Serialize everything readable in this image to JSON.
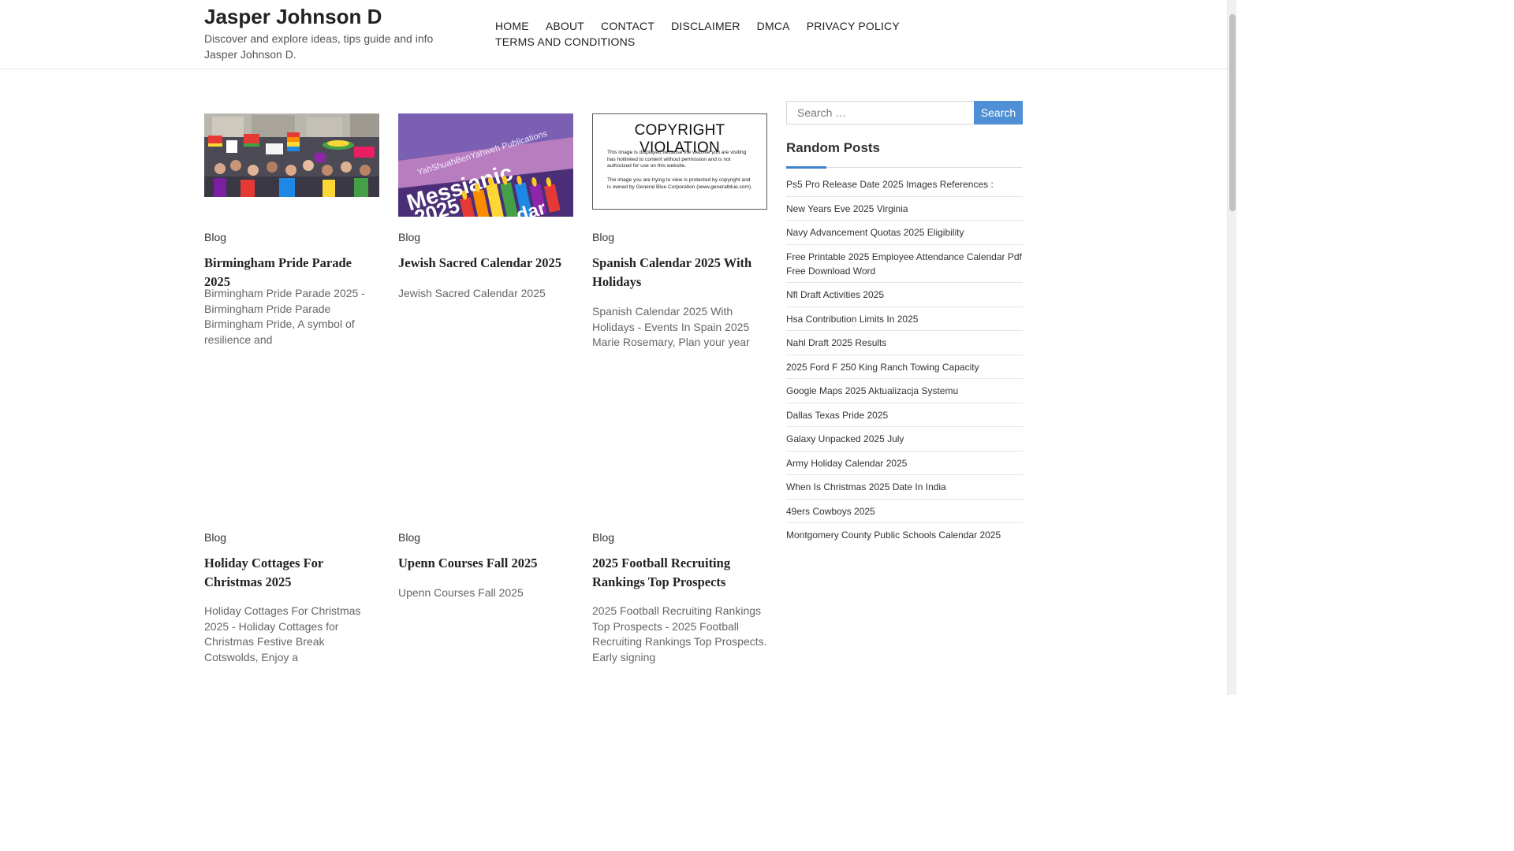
{
  "site": {
    "title": "Jasper Johnson D",
    "description": "Discover and explore ideas, tips guide and info Jasper Johnson D."
  },
  "nav": {
    "items": [
      "HOME",
      "ABOUT",
      "CONTACT",
      "DISCLAIMER",
      "DMCA",
      "PRIVACY POLICY",
      "TERMS AND CONDITIONS"
    ]
  },
  "posts": [
    {
      "category": "Blog",
      "title": "Birmingham Pride Parade 2025",
      "excerpt": "Birmingham Pride Parade 2025 - Birmingham Pride Parade Birmingham Pride, A symbol of resilience and",
      "image": "pride-parade-crowd-photo"
    },
    {
      "category": "Blog",
      "title": "Jewish Sacred Calendar 2025",
      "excerpt": "Jewish Sacred Calendar 2025",
      "image": "messianic-calendar-cover",
      "image_text": {
        "publisher": "YahShuahBenYahweh Publications",
        "word1": "Messianic",
        "word2": "2025",
        "word3": "dar"
      }
    },
    {
      "category": "Blog",
      "title": "Spanish Calendar 2025 With Holidays",
      "excerpt": "Spanish Calendar 2025 With Holidays - Events In Spain 2025 Marie Rosemary, Plan your year",
      "image": "copyright-violation-notice",
      "image_text": {
        "heading": "COPYRIGHT VIOLATION",
        "line1": "This image is displayed because the website you are visiting has hotlinked to content without permission and is not authorized for use on this website.",
        "line2": "The image you are trying to view is protected by copyright and is owned by General Blue Corporation (www.generalblue.com)."
      }
    },
    {
      "category": "Blog",
      "title": "Holiday Cottages For Christmas 2025",
      "excerpt": "Holiday Cottages For Christmas 2025 - Holiday Cottages for Christmas Festive Break Cotswolds, Enjoy a"
    },
    {
      "category": "Blog",
      "title": "Upenn Courses Fall 2025",
      "excerpt": "Upenn Courses Fall 2025"
    },
    {
      "category": "Blog",
      "title": "2025 Football Recruiting Rankings Top Prospects",
      "excerpt": "2025 Football Recruiting Rankings Top Prospects - 2025 Football Recruiting Rankings Top Prospects. Early signing"
    }
  ],
  "sidebar": {
    "search": {
      "placeholder": "Search …",
      "button_label": "Search"
    },
    "random_posts": {
      "title": "Random Posts",
      "items": [
        "Ps5 Pro Release Date 2025 Images References :",
        "New Years Eve 2025 Virginia",
        "Navy Advancement Quotas 2025 Eligibility",
        "Free Printable 2025 Employee Attendance Calendar Pdf Free Download Word",
        "Nfl Draft Activities 2025",
        "Hsa Contribution Limits In 2025",
        "Nahl Draft 2025 Results",
        "2025 Ford F 250 King Ranch Towing Capacity",
        "Google Maps 2025 Aktualizacja Systemu",
        "Dallas Texas Pride 2025",
        "Galaxy Unpacked 2025 July",
        "Army Holiday Calendar 2025",
        "When Is Christmas 2025 Date In India",
        "49ers Cowboys 2025",
        "Montgomery County Public Schools Calendar 2025"
      ]
    }
  },
  "colors": {
    "accent": "#3f7fcb",
    "search_button": "#4f8fd6",
    "title": "#222222",
    "text": "#666666"
  }
}
